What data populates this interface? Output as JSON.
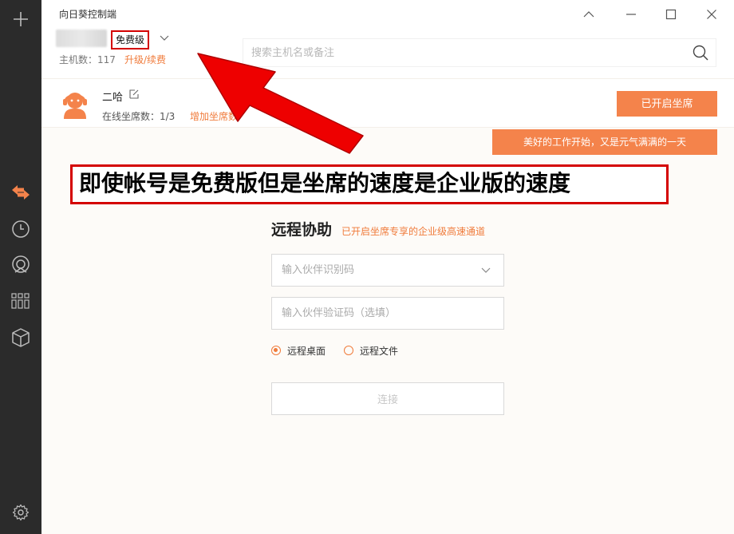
{
  "app": {
    "title": "向日葵控制端"
  },
  "header": {
    "plan_badge": "免费级",
    "host_count": "主机数：117",
    "upgrade_link": "升级/续费",
    "search_placeholder": "搜索主机名或备注"
  },
  "seat": {
    "name": "二哈",
    "online_count": "在线坐席数：1/3",
    "add_link": "增加坐席数",
    "status_button": "已开启坐席"
  },
  "banner": {
    "greeting": "美好的工作开始，又是元气满满的一天"
  },
  "annotation": {
    "text": "即使帐号是免费版但是坐席的速度是企业版的速度"
  },
  "remote": {
    "title": "远程协助",
    "subtitle": "已开启坐席专享的企业级高速通道",
    "partner_id_placeholder": "输入伙伴识别码",
    "partner_code_placeholder": "输入伙伴验证码（选填）",
    "radio_desktop": "远程桌面",
    "radio_file": "远程文件",
    "selected_mode": "远程桌面",
    "connect_label": "连接"
  },
  "colors": {
    "accent": "#f4834b",
    "accent_text": "#f07b3b",
    "sidebar_bg": "#2b2b2b",
    "annotation_red": "#d40000"
  },
  "icons": {
    "sidebar": [
      "plus-icon",
      "remote-transfer-icon",
      "history-clock-icon",
      "camera-lens-icon",
      "grid-apps-icon",
      "cube-icon",
      "settings-gear-icon"
    ],
    "window": [
      "collapse-up-icon",
      "minimize-icon",
      "maximize-icon",
      "close-icon"
    ]
  }
}
